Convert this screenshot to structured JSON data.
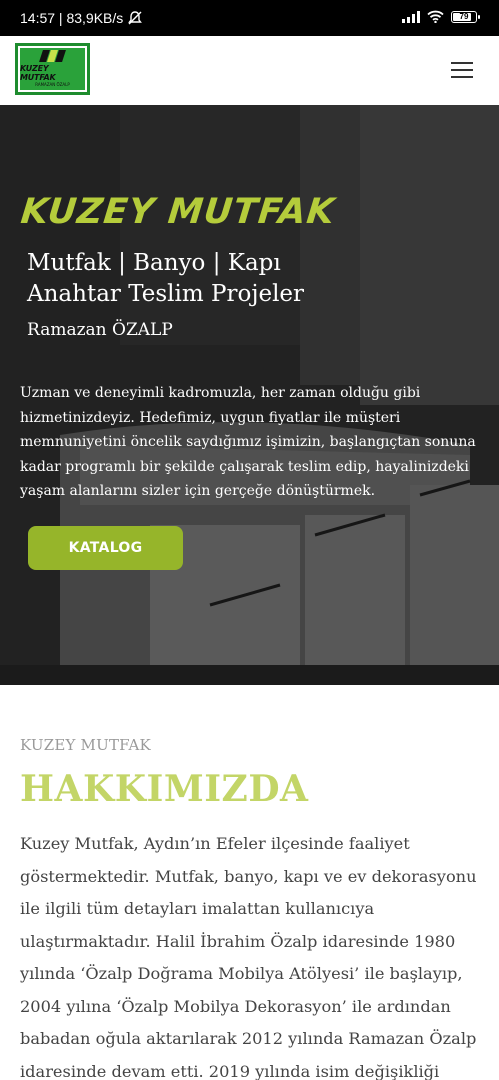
{
  "status_bar": {
    "time_speed": "14:57 | 83,9KB/s",
    "battery": "79"
  },
  "header": {
    "logo_title": "KUZEY MUTFAK",
    "logo_subtitle": "RAMAZAN ÖZALP"
  },
  "hero": {
    "brand": "KUZEY MUTFAK",
    "headline_line1": "Mutfak | Banyo | Kapı",
    "headline_line2": "Anahtar Teslim Projeler",
    "owner": "Ramazan ÖZALP",
    "description": "Uzman ve deneyimli kadromuzla, her zaman olduğu gibi hizmetinizdeyiz. Hedefimiz, uygun fiyatlar ile müşteri memnuniyetini öncelik saydığımız işimizin, başlangıçtan sonuna kadar programlı bir şekilde çalışarak teslim edip, hayalinizdeki yaşam alanlarını sizler için gerçeğe dönüştürmek.",
    "button_label": "KATALOG"
  },
  "about": {
    "eyebrow": "KUZEY MUTFAK",
    "title": "HAKKIMIZDA",
    "text": "Kuzey Mutfak, Aydın’ın Efeler ilçesinde faaliyet göstermektedir. Mutfak, banyo, kapı ve ev dekorasyonu ile ilgili tüm detayları imalattan kullanıcıya ulaştırmaktadır. Halil İbrahim Özalp idaresinde 1980 yılında ‘Özalp Doğrama Mobilya Atölyesi’ ile başlayıp, 2004 yılına ‘Özalp Mobilya Dekorasyon’ ile ardından babadan oğula aktarılarak 2012 yılında Ramazan Özalp idaresinde devam etti. 2019 yılında isim değişikliği"
  },
  "colors": {
    "accent_green": "#b5cc3b",
    "button_green": "#96b52a",
    "title_green": "#c3d567",
    "logo_green": "#2aa23a"
  }
}
